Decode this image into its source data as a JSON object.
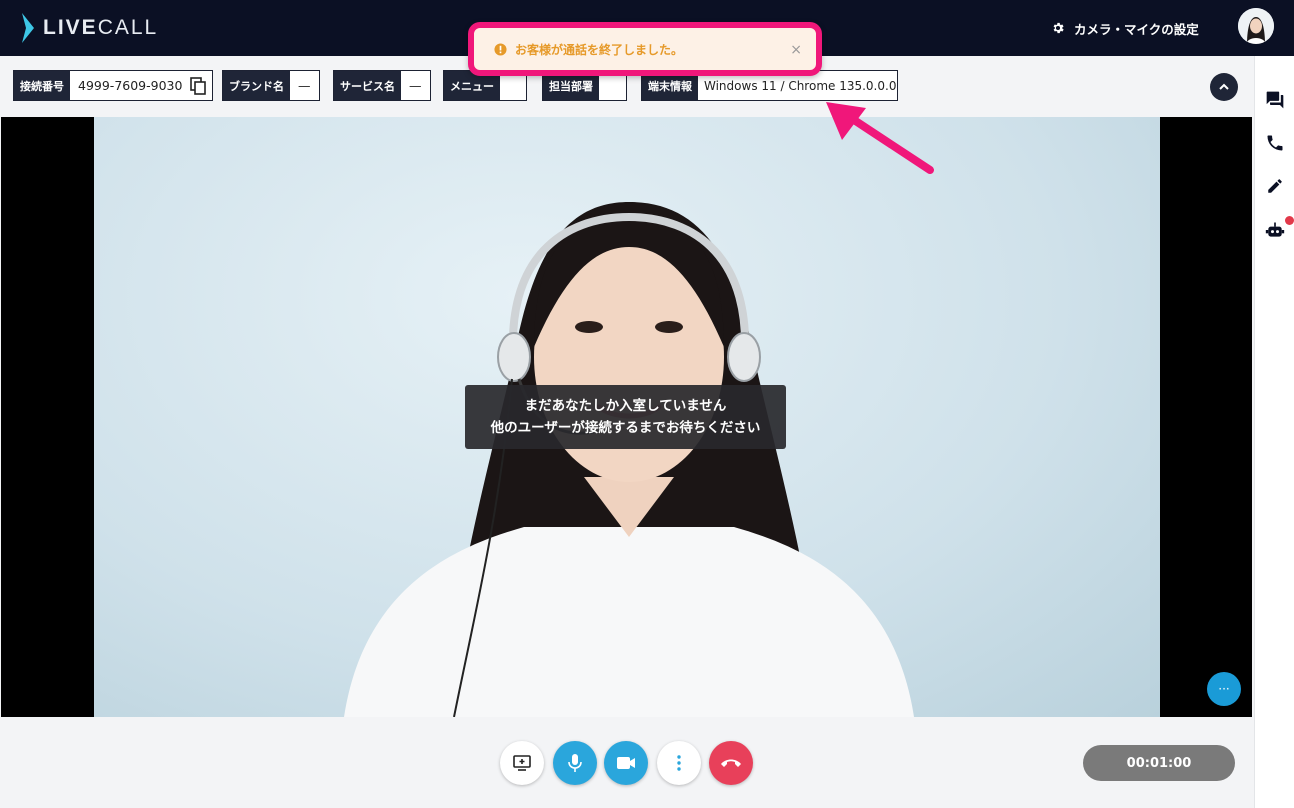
{
  "app": {
    "logo_bold": "LIVE",
    "logo_light": "CALL"
  },
  "header": {
    "settings_label": "カメラ・マイクの設定"
  },
  "info_fields": [
    {
      "label": "接続番号",
      "value": "4999-7609-9030"
    },
    {
      "label": "ブランド名",
      "value": "—"
    },
    {
      "label": "サービス名",
      "value": "—"
    },
    {
      "label": "メニュー",
      "value": ""
    },
    {
      "label": "担当部署",
      "value": ""
    },
    {
      "label": "端末情報",
      "value": "Windows 11 / Chrome 135.0.0.0"
    }
  ],
  "toast": {
    "message": "お客様が通話を終了しました。",
    "close": "×"
  },
  "video": {
    "waiting_line1": "まだあなたしか入室していません",
    "waiting_line2": "他のユーザーが接続するまでお待ちください",
    "more_label": "···"
  },
  "call": {
    "timer": "00:01:00"
  },
  "colors": {
    "accent": "#f0177a",
    "header": "#0b1024",
    "mic": "#2aa6dc",
    "hangup": "#e8405a",
    "toast_text": "#e69a2a"
  }
}
